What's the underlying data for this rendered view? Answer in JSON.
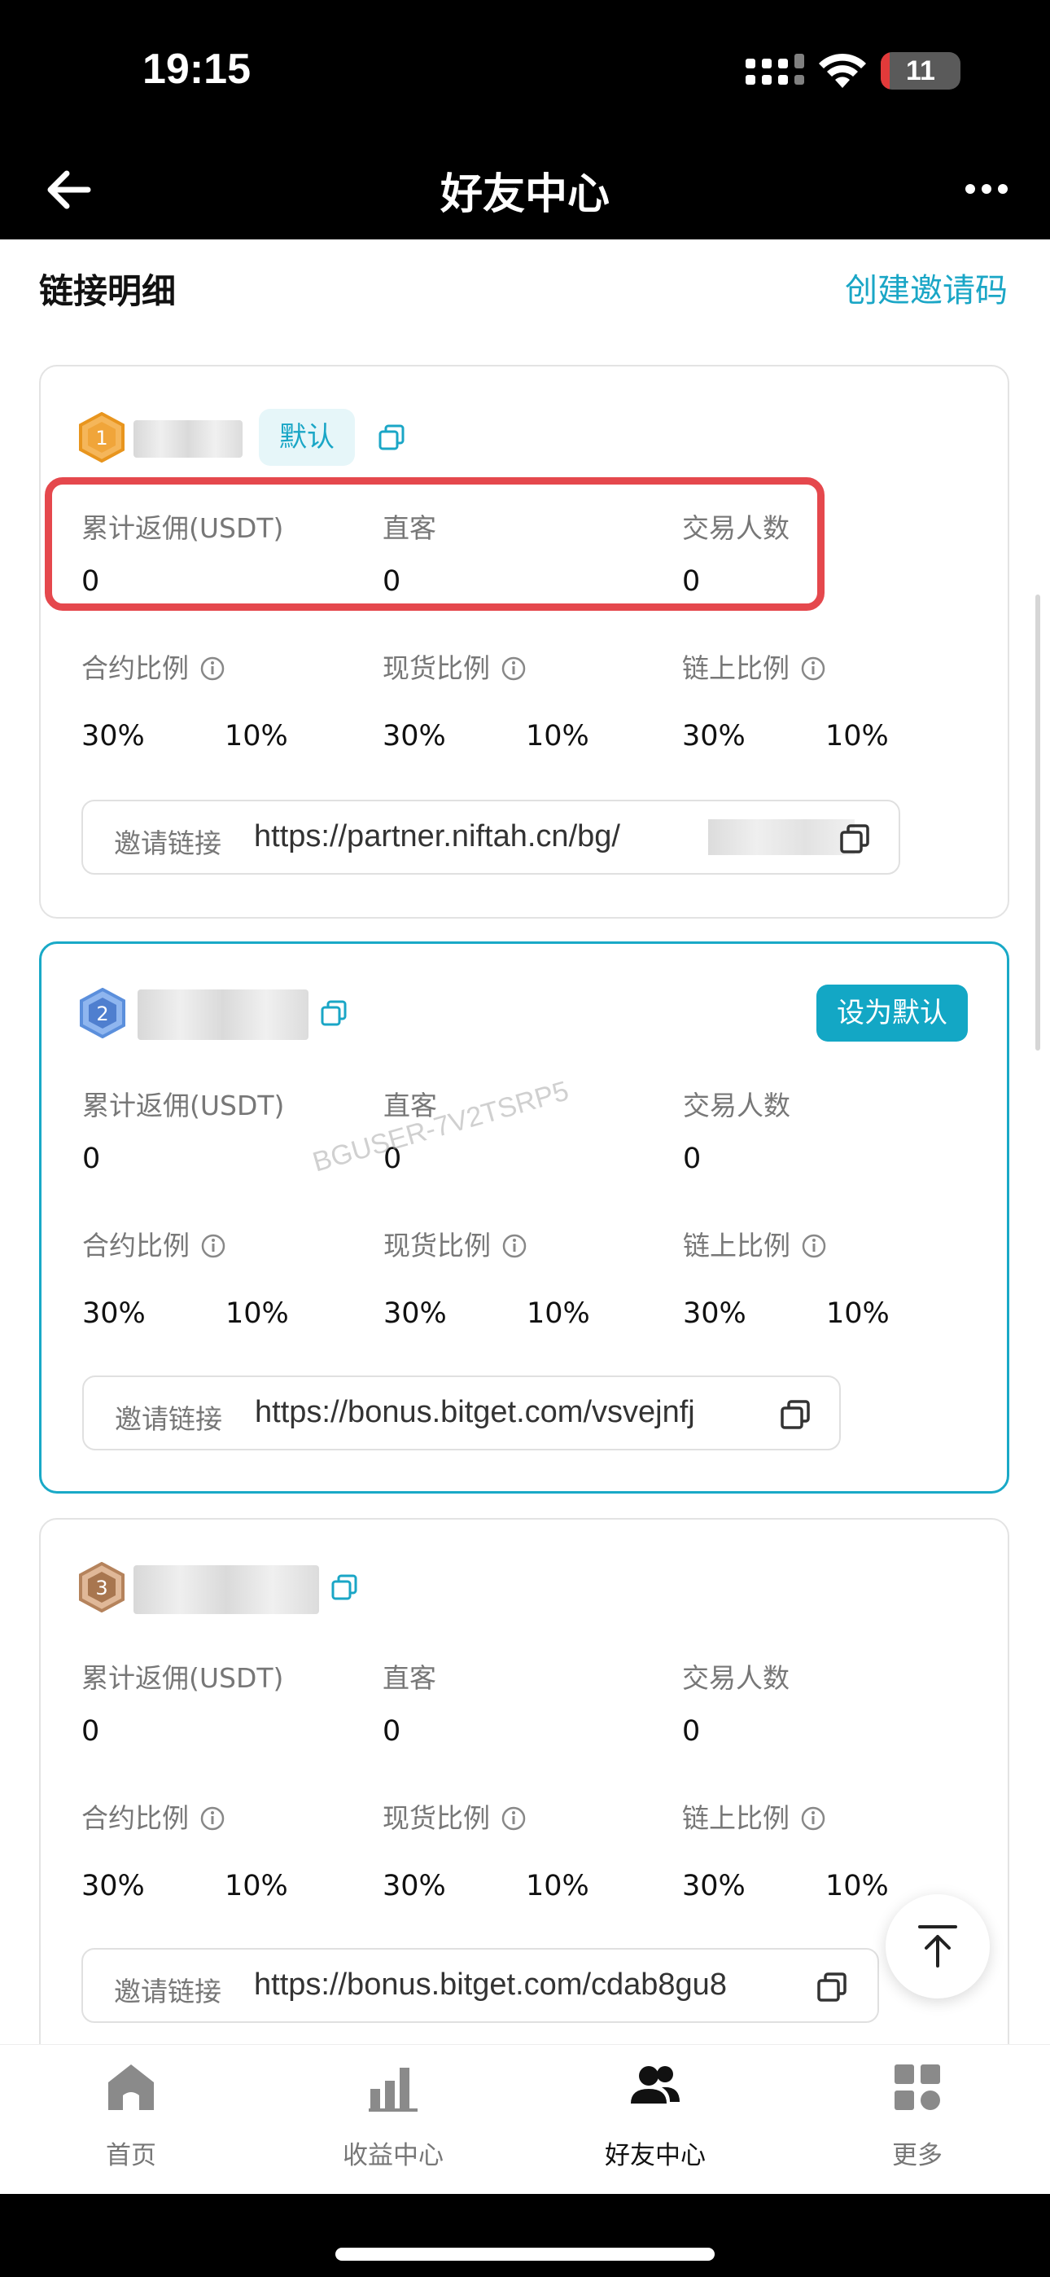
{
  "status_bar": {
    "time": "19:15",
    "battery": "11",
    "battery_level": 0.11
  },
  "nav": {
    "title": "好友中心"
  },
  "section": {
    "title": "链接明细",
    "action": "创建邀请码"
  },
  "cards": [
    {
      "badge": "1",
      "default_tag": "默认",
      "stats_labels": [
        "累计返佣(USDT)",
        "直客",
        "交易人数"
      ],
      "stats_values": [
        "0",
        "0",
        "0"
      ],
      "ratio_labels": [
        "合约比例",
        "现货比例",
        "链上比例"
      ],
      "ratio_values": [
        "30%",
        "10%",
        "30%",
        "10%",
        "30%",
        "10%"
      ],
      "link_label": "邀请链接",
      "link_url": "https://partner.niftah.cn/bg/"
    },
    {
      "badge": "2",
      "set_default": "设为默认",
      "stats_labels": [
        "累计返佣(USDT)",
        "直客",
        "交易人数"
      ],
      "stats_values": [
        "0",
        "0",
        "0"
      ],
      "ratio_labels": [
        "合约比例",
        "现货比例",
        "链上比例"
      ],
      "ratio_values": [
        "30%",
        "10%",
        "30%",
        "10%",
        "30%",
        "10%"
      ],
      "link_label": "邀请链接",
      "link_url": "https://bonus.bitget.com/vsvejnfj"
    },
    {
      "badge": "3",
      "stats_labels": [
        "累计返佣(USDT)",
        "直客",
        "交易人数"
      ],
      "stats_values": [
        "0",
        "0",
        "0"
      ],
      "ratio_labels": [
        "合约比例",
        "现货比例",
        "链上比例"
      ],
      "ratio_values": [
        "30%",
        "10%",
        "30%",
        "10%",
        "30%",
        "10%"
      ],
      "link_label": "邀请链接",
      "link_url": "https://bonus.bitget.com/cdab8gu8"
    }
  ],
  "watermark": "BGUSER-7V2TSRP5",
  "tabs": [
    {
      "label": "首页",
      "icon": "home-icon"
    },
    {
      "label": "收益中心",
      "icon": "bar-chart-icon"
    },
    {
      "label": "好友中心",
      "icon": "users-icon"
    },
    {
      "label": "更多",
      "icon": "grid-icon"
    }
  ],
  "colors": {
    "accent": "#13a7c5",
    "highlight": "#e5484d",
    "header": "#000000"
  }
}
